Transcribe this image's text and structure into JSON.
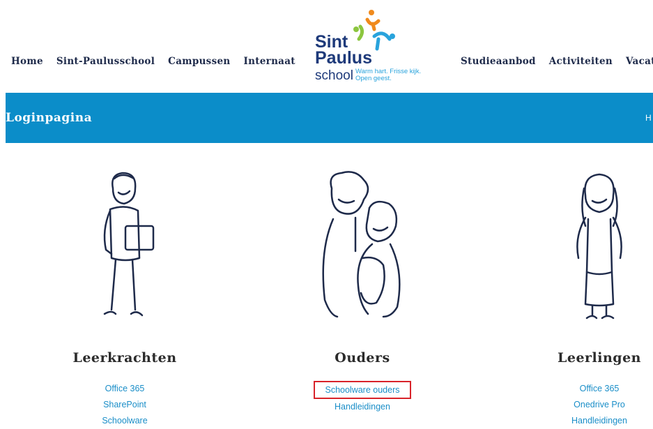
{
  "nav": {
    "left": [
      "Home",
      "Sint-Paulusschool",
      "Campussen",
      "Internaat"
    ],
    "right": [
      "Studieaanbod",
      "Activiteiten",
      "Vacatu"
    ]
  },
  "logo": {
    "line1": "Sint",
    "line2": "Paulus",
    "line3": "school",
    "tagline1": "Warm hart. Frisse kijk.",
    "tagline2": "Open geest.",
    "colors": {
      "orange": "#f08a1c",
      "green": "#8cc63f",
      "blue": "#29a3dc",
      "navy": "#1e3a7a"
    }
  },
  "banner": {
    "title": "Loginpagina",
    "crumb": "H",
    "color": "#0b8dc9"
  },
  "columns": [
    {
      "heading": "Leerkrachten",
      "links": [
        "Office 365",
        "SharePoint",
        "Schoolware"
      ]
    },
    {
      "heading": "Ouders",
      "links": [
        "Schoolware ouders",
        "Handleidingen"
      ],
      "highlighted_link": "Schoolware ouders"
    },
    {
      "heading": "Leerlingen",
      "links": [
        "Office 365",
        "Onedrive Pro",
        "Handleidingen"
      ]
    }
  ]
}
